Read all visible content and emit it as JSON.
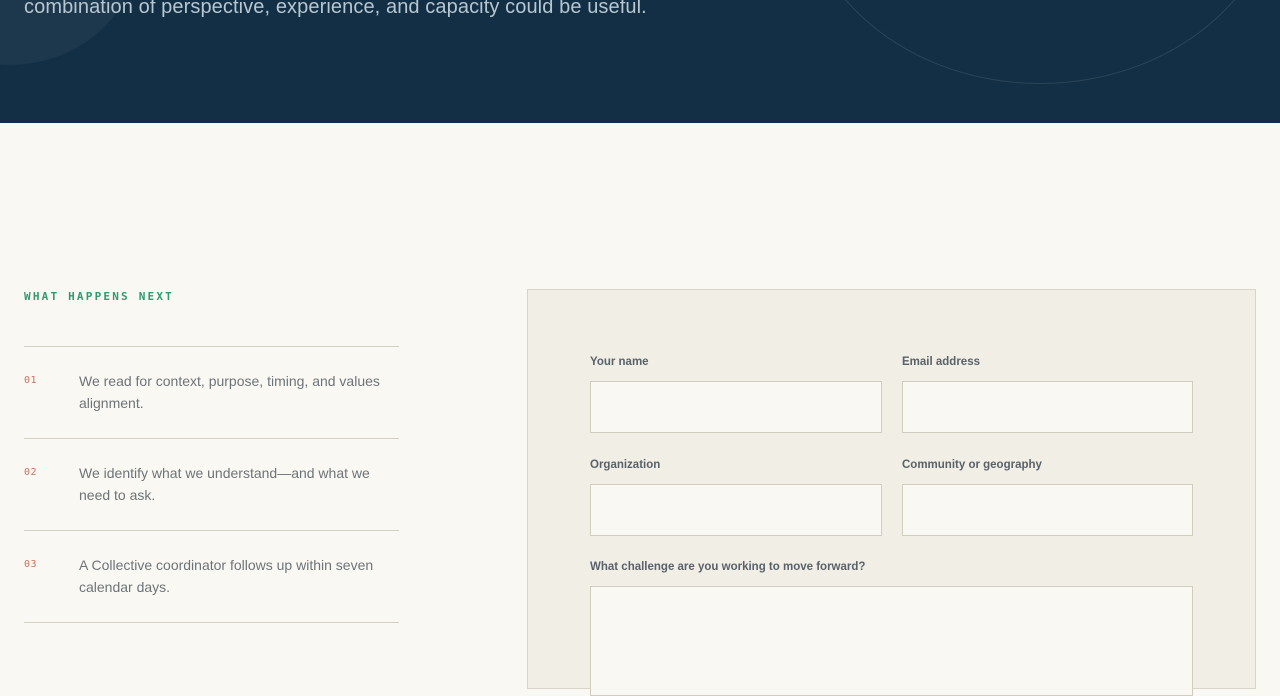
{
  "hero": {
    "text": "combination of perspective, experience, and capacity could be useful."
  },
  "next_steps": {
    "eyebrow": "WHAT HAPPENS NEXT",
    "items": [
      {
        "number": "01",
        "text": "We read for context, purpose, timing, and values alignment."
      },
      {
        "number": "02",
        "text": "We identify what we understand—and what we need to ask."
      },
      {
        "number": "03",
        "text": "A Collective coordinator follows up within seven calendar days."
      }
    ]
  },
  "form": {
    "name": {
      "label": "Your name",
      "value": ""
    },
    "email": {
      "label": "Email address",
      "value": ""
    },
    "organization": {
      "label": "Organization",
      "value": ""
    },
    "community": {
      "label": "Community or geography",
      "value": ""
    },
    "challenge": {
      "label": "What challenge are you working to move forward?",
      "value": ""
    }
  },
  "colors": {
    "hero_bg": "#132f45",
    "page_bg": "#faf8f2",
    "eyebrow_accent": "#2f9a72",
    "step_number": "#c97062"
  }
}
